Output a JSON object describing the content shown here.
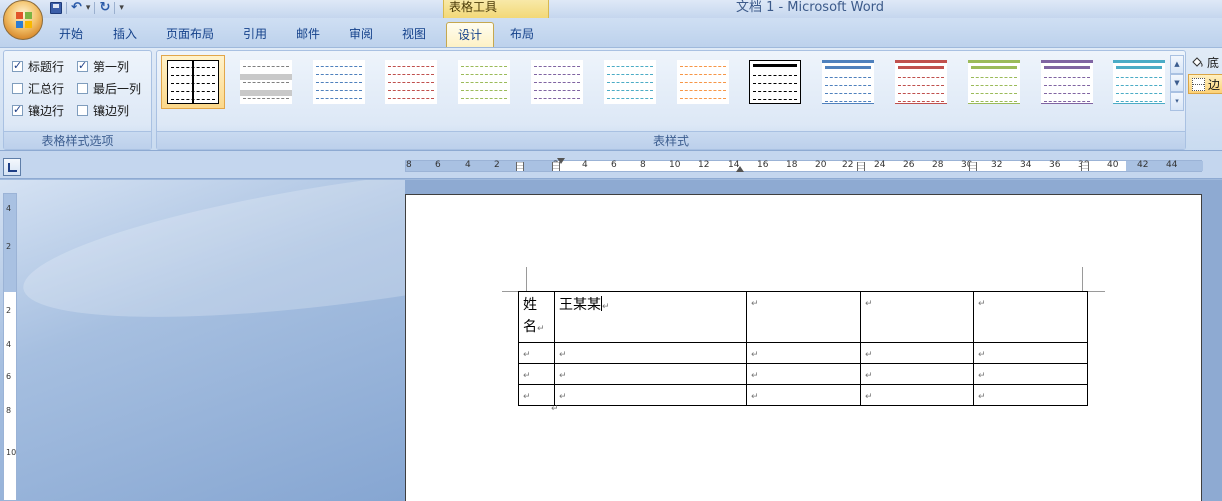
{
  "window": {
    "title": "文档 1 - Microsoft Word",
    "context_tab_group": "表格工具"
  },
  "quick_access": {
    "items": [
      "save-icon",
      "undo-icon",
      "redo-icon",
      "customize-icon"
    ]
  },
  "tabs": [
    {
      "label": "开始"
    },
    {
      "label": "插入"
    },
    {
      "label": "页面布局"
    },
    {
      "label": "引用"
    },
    {
      "label": "邮件"
    },
    {
      "label": "审阅"
    },
    {
      "label": "视图"
    },
    {
      "label": "设计",
      "active": true
    },
    {
      "label": "布局"
    }
  ],
  "style_options": {
    "caption": "表格样式选项",
    "header_row": {
      "label": "标题行",
      "checked": true
    },
    "first_column": {
      "label": "第一列",
      "checked": true
    },
    "total_row": {
      "label": "汇总行",
      "checked": false
    },
    "last_column": {
      "label": "最后一列",
      "checked": false
    },
    "banded_rows": {
      "label": "镶边行",
      "checked": true
    },
    "banded_columns": {
      "label": "镶边列",
      "checked": false
    }
  },
  "table_styles": {
    "caption": "表样式",
    "colors": [
      "#000000",
      "#7f7f7f",
      "#4f81bd",
      "#c0504d",
      "#9bbb59",
      "#8064a2",
      "#4bacc6",
      "#f79646",
      "#000000",
      "#4f81bd",
      "#c0504d",
      "#9bbb59",
      "#8064a2",
      "#4bacc6"
    ]
  },
  "right_tools": {
    "shading": "底",
    "borders": "边"
  },
  "ruler": {
    "h_numbers": [
      "8",
      "6",
      "4",
      "2",
      "2",
      "4",
      "6",
      "8",
      "10",
      "12",
      "14",
      "16",
      "18",
      "20",
      "22",
      "24",
      "26",
      "28",
      "30",
      "32",
      "34",
      "36",
      "38",
      "40",
      "42",
      "44"
    ],
    "v_numbers": [
      "4",
      "2",
      "2",
      "4",
      "6",
      "8",
      "10"
    ]
  },
  "document": {
    "table": {
      "rows": [
        [
          "姓名",
          "王某某",
          "",
          "",
          ""
        ],
        [
          "",
          "",
          "",
          "",
          ""
        ],
        [
          "",
          "",
          "",
          "",
          ""
        ],
        [
          "",
          "",
          "",
          "",
          ""
        ]
      ]
    },
    "paragraph_mark": "↵"
  }
}
